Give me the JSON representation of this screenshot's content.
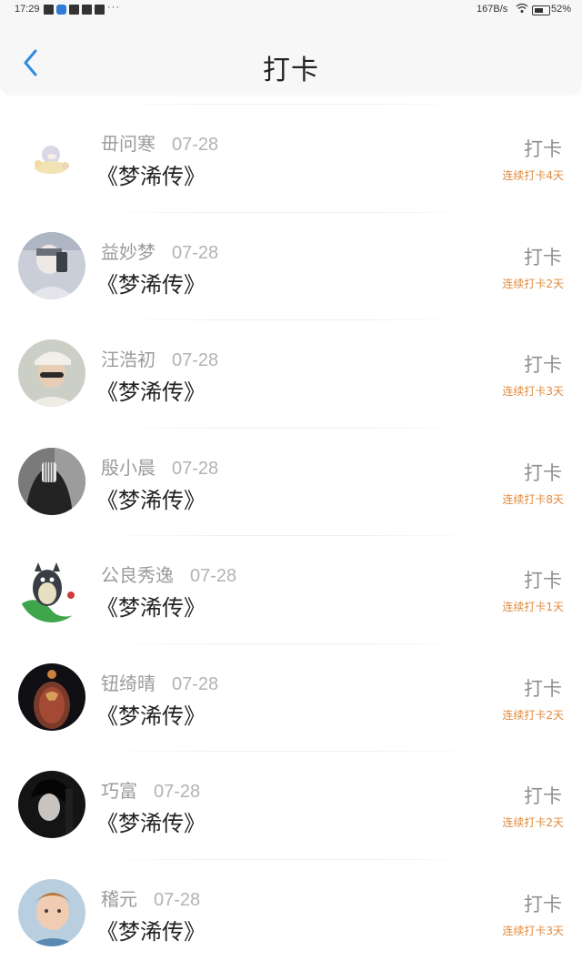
{
  "status_bar": {
    "time": "17:29",
    "net_speed": "167B/s",
    "battery_pct": "52%",
    "more_glyph": "···"
  },
  "header": {
    "title": "打卡",
    "back_icon": "chevron-left-icon",
    "accent_color": "#2e8be0"
  },
  "records": [
    {
      "name": "毌问寒",
      "date": "07-28",
      "book": "《梦浠传》",
      "action": "打卡",
      "streak": "连续打卡4天",
      "avatar_icon": "cartoon-avatar-icon"
    },
    {
      "name": "益妙梦",
      "date": "07-28",
      "book": "《梦浠传》",
      "action": "打卡",
      "streak": "连续打卡2天",
      "avatar_icon": "selfie-avatar-icon"
    },
    {
      "name": "汪浩初",
      "date": "07-28",
      "book": "《梦浠传》",
      "action": "打卡",
      "streak": "连续打卡3天",
      "avatar_icon": "cap-avatar-icon"
    },
    {
      "name": "殷小晨",
      "date": "07-28",
      "book": "《梦浠传》",
      "action": "打卡",
      "streak": "连续打卡8天",
      "avatar_icon": "mask-avatar-icon"
    },
    {
      "name": "公良秀逸",
      "date": "07-28",
      "book": "《梦浠传》",
      "action": "打卡",
      "streak": "连续打卡1天",
      "avatar_icon": "totoro-avatar-icon"
    },
    {
      "name": "钮绮晴",
      "date": "07-28",
      "book": "《梦浠传》",
      "action": "打卡",
      "streak": "连续打卡2天",
      "avatar_icon": "tattoo-avatar-icon"
    },
    {
      "name": "巧富",
      "date": "07-28",
      "book": "《梦浠传》",
      "action": "打卡",
      "streak": "连续打卡2天",
      "avatar_icon": "dark-portrait-avatar-icon"
    },
    {
      "name": "稽元",
      "date": "07-28",
      "book": "《梦浠传》",
      "action": "打卡",
      "streak": "连续打卡3天",
      "avatar_icon": "child-avatar-icon"
    }
  ],
  "colors": {
    "name": "#9b9b9b",
    "book": "#222222",
    "streak": "#e08a3d",
    "action": "#8f8f8f"
  }
}
